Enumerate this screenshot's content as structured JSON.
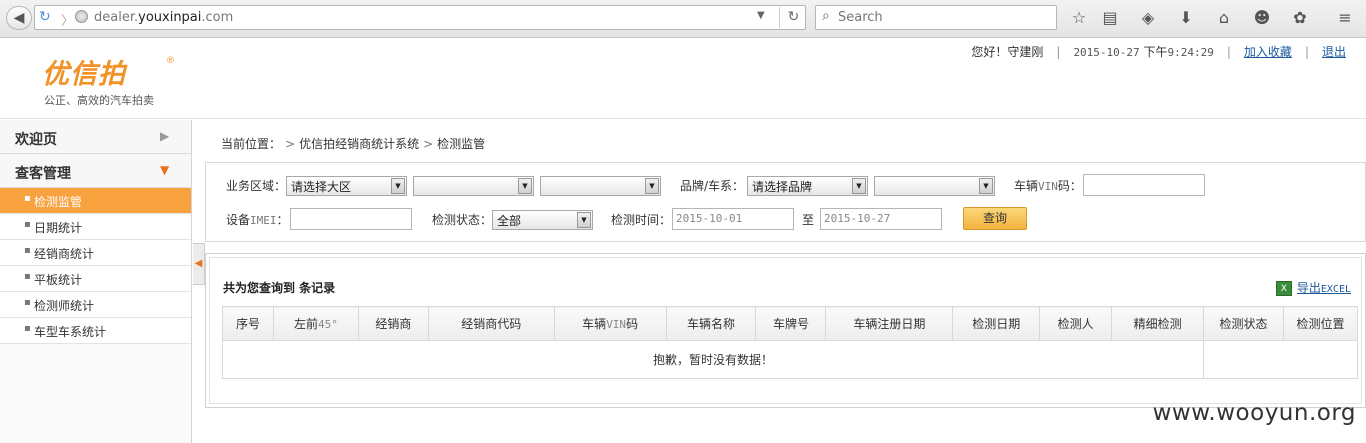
{
  "browser": {
    "url_host": "dealer.",
    "url_domain": "youxinpai",
    "url_tld": ".com",
    "search_placeholder": "Search"
  },
  "header": {
    "logo_text": "优信拍",
    "slogan": "公正、高效的汽车拍卖",
    "greeting": "您好！守建刚",
    "date": "2015-10-27",
    "time_prefix": "下午",
    "time": "9:24:29",
    "favorite_link": "加入收藏",
    "logout_link": "退出"
  },
  "sidebar": {
    "sections": [
      {
        "label": "欢迎页",
        "arrow": "▶"
      },
      {
        "label": "查客管理",
        "arrow": "▼"
      }
    ],
    "items": [
      {
        "label": "检测监管",
        "active": true
      },
      {
        "label": "日期统计"
      },
      {
        "label": "经销商统计"
      },
      {
        "label": "平板统计"
      },
      {
        "label": "检测师统计"
      },
      {
        "label": "车型车系统计"
      }
    ]
  },
  "breadcrumb": {
    "prefix": "当前位置：",
    "sep": ">",
    "system": "优信拍经销商统计系统",
    "current": "检测监管"
  },
  "filters": {
    "region_label": "业务区域：",
    "region_value": "请选择大区",
    "brand_label": "品牌/车系：",
    "brand_value": "请选择品牌",
    "vin_label_a": "车辆",
    "vin_label_mono": "VIN",
    "vin_label_b": "码：",
    "imei_label_a": "设备",
    "imei_label_mono": "IMEI",
    "imei_label_b": "：",
    "status_label": "检测状态：",
    "status_value": "全部",
    "time_label": "检测时间：",
    "date_from": "2015-10-01",
    "to_label": "至",
    "date_to": "2015-10-27",
    "query_button": "查询"
  },
  "results": {
    "count_text": "共为您查询到  条记录",
    "export_label": "导出",
    "export_mono": "EXCEL",
    "columns": [
      "序号",
      "左前",
      "经销商",
      "经销商代码",
      "车辆VIN码",
      "车辆名称",
      "车牌号",
      "车辆注册日期",
      "检测日期",
      "检测人",
      "精细检测",
      "检测状态",
      "检测位置"
    ],
    "col2_mono": "45°",
    "col5_a": "车辆",
    "col5_mono": "VIN",
    "col5_b": "码",
    "empty_message": "抱歉，暂时没有数据！"
  },
  "watermark": "www.wooyun.org"
}
